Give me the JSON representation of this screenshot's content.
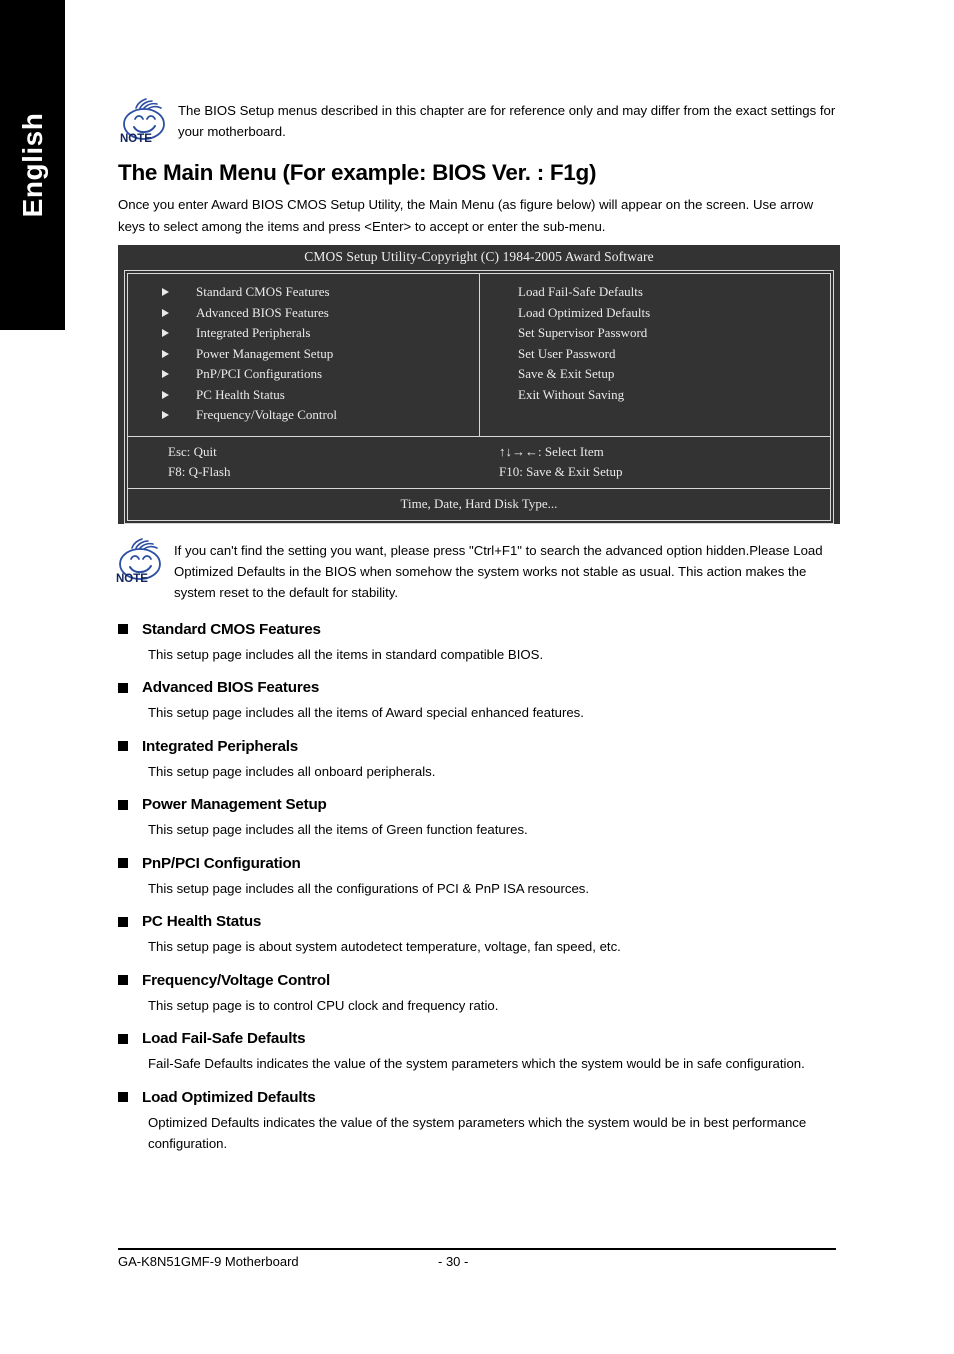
{
  "language_tab": {
    "label": "English"
  },
  "note_top": {
    "icon": "note-smiley-icon",
    "text": "The BIOS Setup menus described in this chapter are for reference only and may differ from the exact settings for your motherboard."
  },
  "heading": "The Main Menu (For example: BIOS Ver. : F1g)",
  "intro": "Once you enter Award BIOS CMOS Setup Utility, the Main Menu (as figure below) will appear on the screen.  Use arrow keys to select among the items and press <Enter> to accept or enter the sub-menu.",
  "bios": {
    "title": "CMOS Setup Utility-Copyright (C) 1984-2005 Award Software",
    "left_items": [
      "Standard CMOS Features",
      "Advanced BIOS Features",
      "Integrated Peripherals",
      "Power Management Setup",
      "PnP/PCI Configurations",
      "PC Health Status",
      "Frequency/Voltage Control"
    ],
    "right_items": [
      "Load Fail-Safe Defaults",
      "Load Optimized Defaults",
      "Set Supervisor Password",
      "Set User Password",
      "Save & Exit Setup",
      "Exit Without Saving"
    ],
    "keys": {
      "left_top": "Esc: Quit",
      "left_bottom": "F8: Q-Flash",
      "right_top": "↑↓→←: Select Item",
      "right_bottom": "F10: Save & Exit Setup"
    },
    "status": "Time, Date, Hard Disk Type...",
    "background_color": "#333333",
    "text_color": "#eaeaea"
  },
  "note_bottom": {
    "icon": "note-smiley-icon",
    "text": "If you can't find the setting you want, please press \"Ctrl+F1\" to search the advanced option hidden.Please Load Optimized Defaults in the BIOS when somehow the system works not stable as usual. This action makes the system reset to the default for stability."
  },
  "sections": [
    {
      "title": "Standard CMOS Features",
      "body": "This setup page includes all the items in standard compatible BIOS."
    },
    {
      "title": "Advanced BIOS Features",
      "body": "This setup page includes all the items of Award special enhanced features."
    },
    {
      "title": "Integrated Peripherals",
      "body": "This setup page includes all onboard peripherals."
    },
    {
      "title": "Power Management Setup",
      "body": "This setup page includes all the items of Green function features."
    },
    {
      "title": "PnP/PCI Configuration",
      "body": "This setup page includes all the configurations of PCI & PnP ISA resources."
    },
    {
      "title": "PC Health Status",
      "body": "This setup page is about system autodetect temperature, voltage, fan speed, etc."
    },
    {
      "title": "Frequency/Voltage Control",
      "body": "This setup page is to control CPU clock and frequency ratio."
    },
    {
      "title": "Load Fail-Safe Defaults",
      "body": "Fail-Safe Defaults indicates the value of the system parameters which the system would be in safe configuration."
    },
    {
      "title": "Load Optimized Defaults",
      "body": "Optimized Defaults indicates the value of the system parameters which the system would be in best performance configuration."
    }
  ],
  "footer": {
    "product": "GA-K8N51GMF-9 Motherboard",
    "page_number": "- 30 -"
  }
}
